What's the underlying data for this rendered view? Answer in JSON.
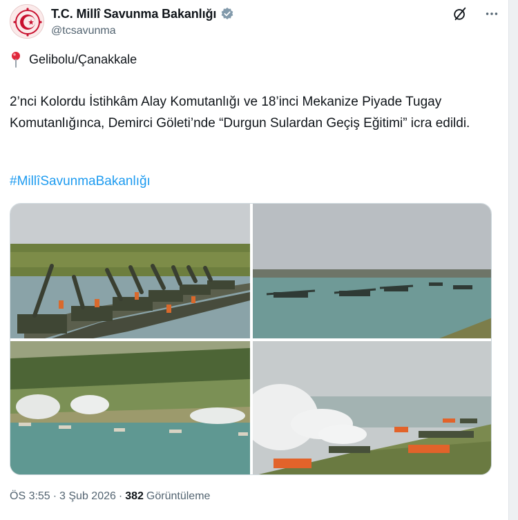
{
  "account": {
    "display_name": "T.C. Millî Savunma Bakanlığı",
    "handle": "@tcsavunma",
    "verified_color": "#829aab"
  },
  "post": {
    "location": "Gelibolu/Çanakkale",
    "text": "2’nci Kolordu İstihkâm Alay Komutanlığı ve 18’inci Mekanize Piyade Tugay Komutanlığınca, Demirci Göleti’nde “Durgun Sulardan Geçiş Eğitimi” icra edildi.",
    "hashtag": "#MillîSavunmaBakanlığı",
    "hashtag_color": "#1d9bf0",
    "media_count": 4
  },
  "meta": {
    "time": "ÖS 3:55",
    "separator": "·",
    "date": "3 Şub 2026",
    "views_count": "382",
    "views_label": "Görüntüleme"
  },
  "icons": {
    "verified": "verified-badge-icon",
    "grok": "grok-icon",
    "more": "more-icon",
    "location": "location-pin-icon"
  }
}
